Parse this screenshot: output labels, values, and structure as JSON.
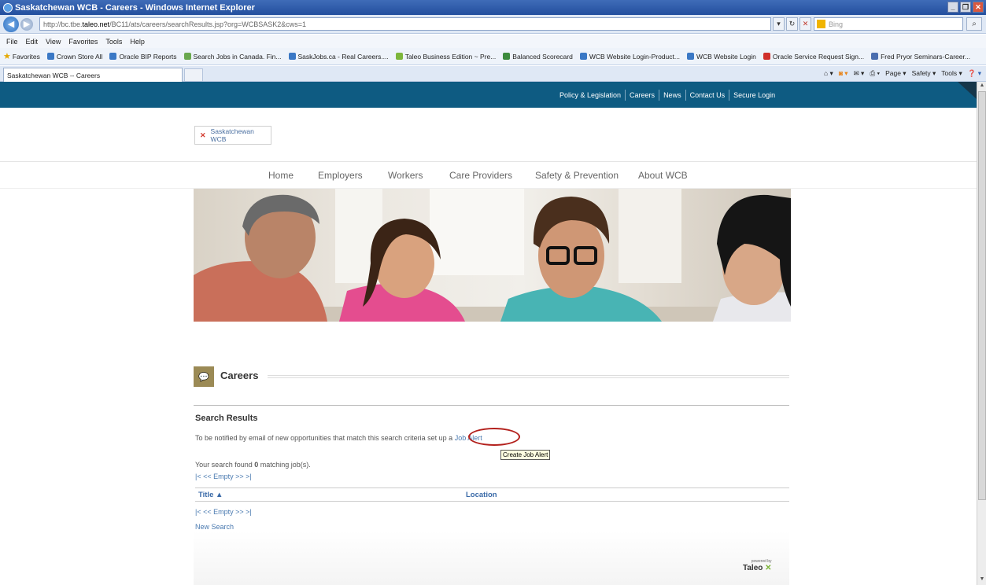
{
  "window": {
    "title": "Saskatchewan WCB - Careers - Windows Internet Explorer"
  },
  "address": {
    "url_prefix": "http://bc.tbe.",
    "url_domain": "taleo.net",
    "url_rest": "/BC11/ats/careers/searchResults.jsp?org=WCBSASK2&cws=1",
    "search_placeholder": "Bing"
  },
  "menu": [
    "File",
    "Edit",
    "View",
    "Favorites",
    "Tools",
    "Help"
  ],
  "favorites": {
    "label": "Favorites",
    "items": [
      "Crown Store All",
      "Oracle BIP Reports",
      "Search Jobs in Canada. Fin...",
      "SaskJobs.ca - Real Careers....",
      "Taleo Business Edition ~ Pre...",
      "Balanced Scorecard",
      "WCB Website Login-Product...",
      "WCB Website Login",
      "Oracle Service Request Sign...",
      "Fred Pryor Seminars-Career..."
    ]
  },
  "tab": {
    "label": "Saskatchewan WCB -- Careers"
  },
  "commandbar": [
    "Page ▾",
    "Safety ▾",
    "Tools ▾"
  ],
  "site": {
    "utility_nav": [
      "Policy & Legislation",
      "Careers",
      "News",
      "Contact Us",
      "Secure Login"
    ],
    "logo_alt": "Saskatchewan WCB",
    "main_nav": [
      "Home",
      "Employers",
      "Workers",
      "Care Providers",
      "Safety & Prevention",
      "About WCB"
    ]
  },
  "careers": {
    "section_title": "Careers",
    "results_heading": "Search Results",
    "notify_text": "To be notified by email of new opportunities that match this search criteria set up a",
    "job_alert_link": "Job Alert",
    "tooltip": "Create Job Alert",
    "found_prefix": "Your search found ",
    "found_count": "0",
    "found_suffix": " matching job(s).",
    "pager": "|< << Empty >> >|",
    "col_title": "Title",
    "col_location": "Location",
    "new_search": "New Search",
    "powered_by": "powered by",
    "taleo": "Taleo"
  }
}
